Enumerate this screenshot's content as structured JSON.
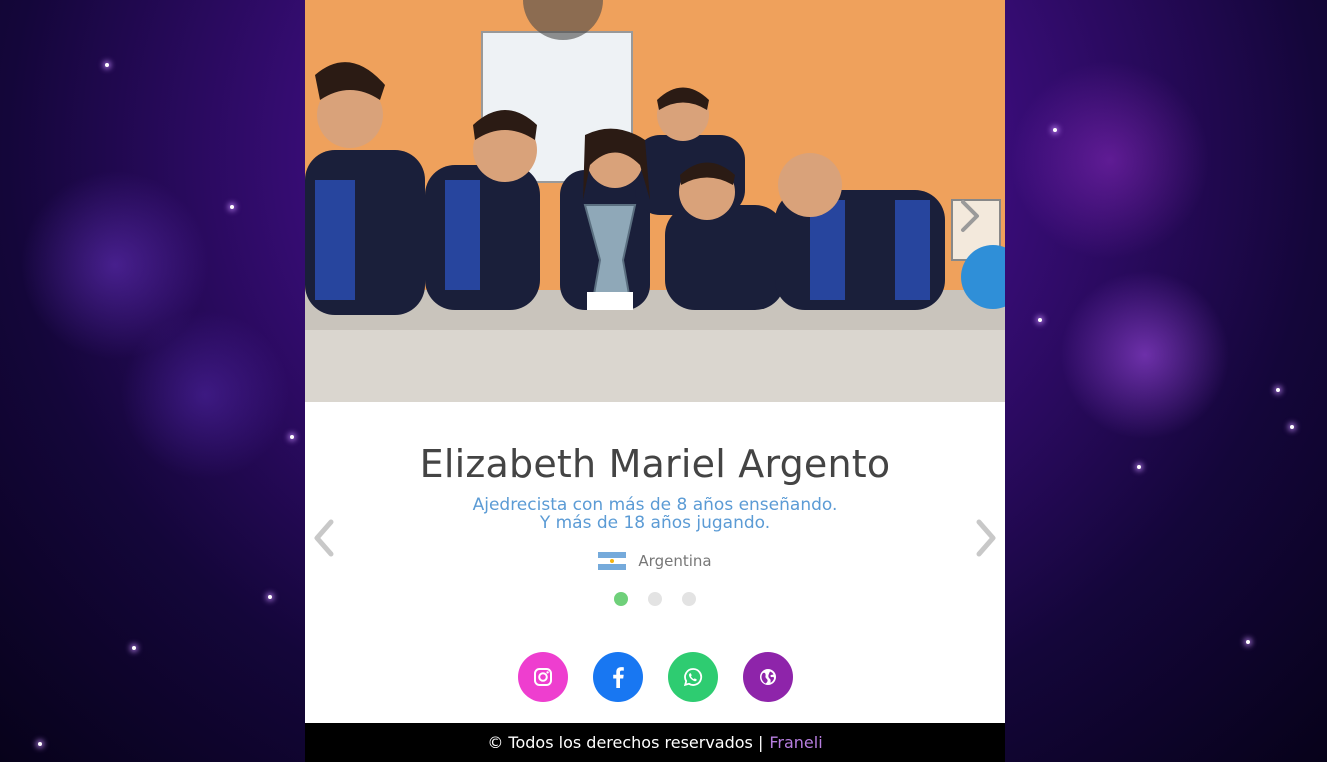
{
  "profile": {
    "name": "Elizabeth Mariel Argento",
    "description_line1": "Ajedrecista con más de 8 años enseñando.",
    "description_line2": "Y más de 18 años jugando.",
    "country": "Argentina"
  },
  "carousel": {
    "dots": [
      {
        "active": true
      },
      {
        "active": false
      },
      {
        "active": false
      }
    ]
  },
  "socials": [
    {
      "name": "instagram",
      "color": "#ee3ecf"
    },
    {
      "name": "facebook",
      "color": "#1877f2"
    },
    {
      "name": "whatsapp",
      "color": "#2ecc71"
    },
    {
      "name": "website",
      "color": "#8e24aa"
    }
  ],
  "footer": {
    "copyright": "© Todos los derechos reservados |",
    "brand": "Franeli"
  },
  "colors": {
    "name": "#444444",
    "description": "#5b9bd5",
    "active_dot": "#6fd07a",
    "footer_bg": "#000000",
    "brand": "#b77ee0"
  }
}
